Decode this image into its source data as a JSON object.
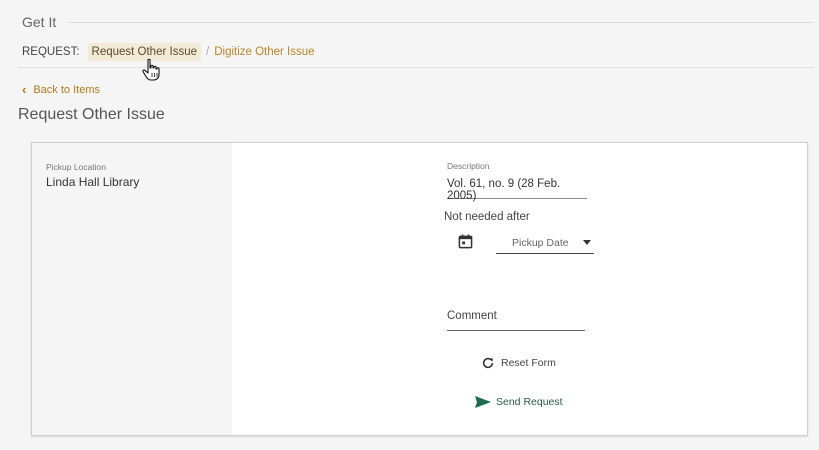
{
  "getit": {
    "title": "Get It"
  },
  "request": {
    "label": "REQUEST:",
    "tabs": [
      {
        "label": "Request Other Issue",
        "active": true
      },
      {
        "label": "Digitize Other Issue",
        "active": false
      }
    ],
    "separator": "/"
  },
  "back_link": {
    "label": "Back to Items"
  },
  "page_title": "Request Other Issue",
  "form": {
    "pickup_location": {
      "label": "Pickup Location",
      "value": "Linda Hall Library"
    },
    "description": {
      "label": "Description",
      "value": "Vol. 61, no. 9 (28 Feb. 2005)"
    },
    "not_needed_after": {
      "label": "Not needed after"
    },
    "pickup_date": {
      "placeholder": "Pickup Date"
    },
    "comment": {
      "placeholder": "Comment"
    },
    "reset_label": "Reset Form",
    "send_label": "Send Request"
  },
  "colors": {
    "accent_gold": "#b8852a",
    "active_tab_bg": "#f4ead8",
    "send_green": "#1d6b4a"
  },
  "icons": {
    "back": "chevron-left-icon",
    "calendar": "calendar-icon",
    "dropdown": "caret-down-icon",
    "reset": "refresh-icon",
    "send": "send-icon",
    "cursor": "hand-pointer-icon"
  }
}
